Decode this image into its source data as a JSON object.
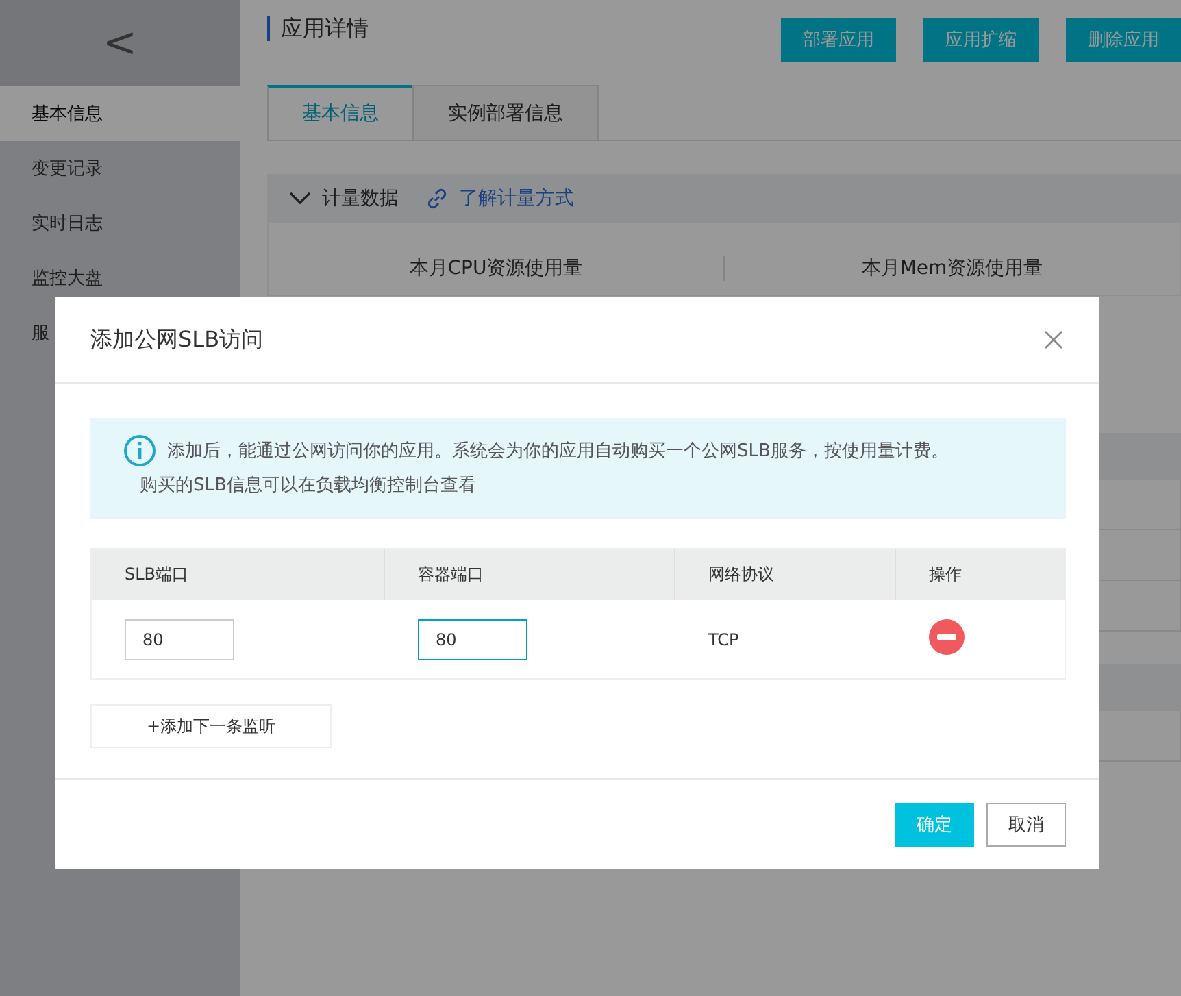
{
  "sidebar": {
    "back": "<",
    "items": [
      {
        "label": "基本信息",
        "selected": true
      },
      {
        "label": "变更记录",
        "selected": false
      },
      {
        "label": "实时日志",
        "selected": false
      },
      {
        "label": "监控大盘",
        "selected": false
      },
      {
        "label": "服",
        "selected": false
      }
    ]
  },
  "page": {
    "title": "应用详情",
    "actions": [
      "部署应用",
      "应用扩缩",
      "删除应用"
    ],
    "tabs": [
      {
        "label": "基本信息",
        "selected": true
      },
      {
        "label": "实例部署信息",
        "selected": false
      }
    ],
    "section": {
      "title": "计量数据",
      "link": "了解计量方式",
      "expanded": true
    },
    "metrics": [
      "本月CPU资源使用量",
      "本月Mem资源使用量"
    ]
  },
  "dialog": {
    "title": "添加公网SLB访问",
    "notice": [
      "添加后，能通过公网访问你的应用。系统会为你的应用自动购买一个公网SLB服务，按使用量计费。",
      "购买的SLB信息可以在负载均衡控制台查看"
    ],
    "table": {
      "columns": [
        "SLB端口",
        "容器端口",
        "网络协议",
        "操作"
      ],
      "rows": [
        {
          "slb_port": {
            "value": "80",
            "focused": false
          },
          "container_port": {
            "value": "80",
            "focused": true
          },
          "protocol": "TCP"
        }
      ]
    },
    "add_button": "+添加下一条监听",
    "buttons": [
      {
        "label": "确定",
        "kind": "primary"
      },
      {
        "label": "取消",
        "kind": "secondary"
      }
    ]
  }
}
